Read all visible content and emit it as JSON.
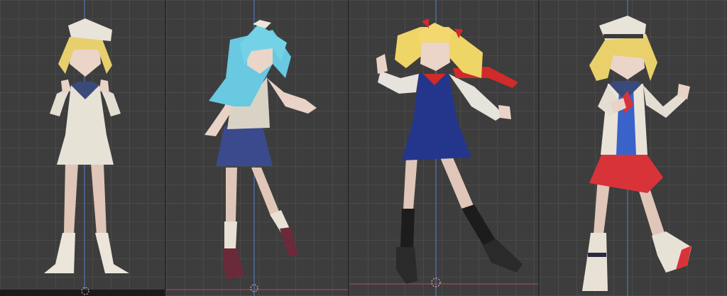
{
  "viewports": [
    {
      "id": "viewport-1",
      "character": "sailor-dress-blonde",
      "colors": {
        "hair": "#e8cf6e",
        "skin": "#e9d3c6",
        "outfit": "#e7e2d6",
        "accent": "#3a4a7a",
        "shoes": "#e8e2d6"
      }
    },
    {
      "id": "viewport-2",
      "character": "blue-hair-sailor",
      "colors": {
        "hair": "#68c9e0",
        "skin": "#e9d3c6",
        "outfit": "#d9d3c6",
        "skirt": "#3b4a8c",
        "shoes": "#6b2a3a"
      }
    },
    {
      "id": "viewport-3",
      "character": "twin-tail-blonde-blue-dress",
      "colors": {
        "hair": "#efd466",
        "skin": "#e9d3c6",
        "outfit": "#e6e2dc",
        "dress": "#24368c",
        "ribbon": "#d02a2a",
        "socks": "#1c1c1c"
      }
    },
    {
      "id": "viewport-4",
      "character": "sailor-blonde-red-skirt",
      "colors": {
        "hair": "#e9d06a",
        "skin": "#e9d3c6",
        "outfit": "#e9e3d8",
        "vest": "#3a63c9",
        "skirt": "#d9333a",
        "shoes": "#e8e2d6"
      }
    }
  ],
  "ui": {
    "axis_color": "#4f76b4",
    "ground_color": "#a04a55",
    "origin_color": "#f0c8c8",
    "grid_color": "#4a4a4a"
  }
}
